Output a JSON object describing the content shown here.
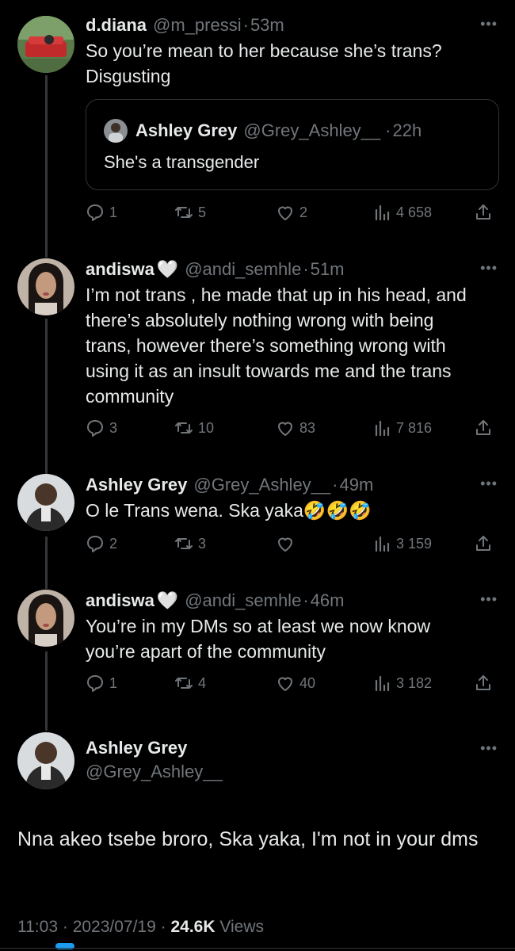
{
  "tweets": [
    {
      "name": "d.diana",
      "handle": "@m_pressi",
      "sep": "·",
      "time": "53m",
      "text": "So you’re mean to her because she’s trans? Disgusting",
      "quote": {
        "name": "Ashley Grey",
        "handle": "@Grey_Ashley__",
        "sep": "·",
        "time": "22h",
        "text": "She's a transgender"
      },
      "replies": "1",
      "retweets": "5",
      "likes": "2",
      "views": "4 658"
    },
    {
      "name": "andiswa",
      "handle": "@andi_semhle",
      "sep": "·",
      "time": "51m",
      "text": "I’m not trans , he made that up in his head, and there’s absolutely nothing wrong with being trans, however there’s something wrong with using it as an insult towards me and the trans community",
      "replies": "3",
      "retweets": "10",
      "likes": "83",
      "views": "7 816"
    },
    {
      "name": "Ashley Grey",
      "handle": "@Grey_Ashley__",
      "sep": "·",
      "time": "49m",
      "text": "O le Trans wena. Ska yaka",
      "emoji": "🤣🤣🤣",
      "replies": "2",
      "retweets": "3",
      "likes": "",
      "views": "3 159"
    },
    {
      "name": "andiswa",
      "handle": "@andi_semhle",
      "sep": "·",
      "time": "46m",
      "text": "You’re in my DMs so at least we now know you’re apart of the community",
      "replies": "1",
      "retweets": "4",
      "likes": "40",
      "views": "3 182"
    }
  ],
  "main": {
    "name": "Ashley Grey",
    "handle": "@Grey_Ashley__",
    "text": "Nna akeo tsebe broro, Ska yaka, I'm not in your dms",
    "time": "11:03",
    "sep1": "·",
    "date": "2023/07/19",
    "sep2": "·",
    "views": "24.6K",
    "views_label": "Views"
  },
  "more_glyph": "•••",
  "heart_glyph": "🤍",
  "colors": {
    "accent": "#1d9bf0",
    "muted": "#71767b",
    "text": "#e7e9ea",
    "bg": "#000000"
  }
}
